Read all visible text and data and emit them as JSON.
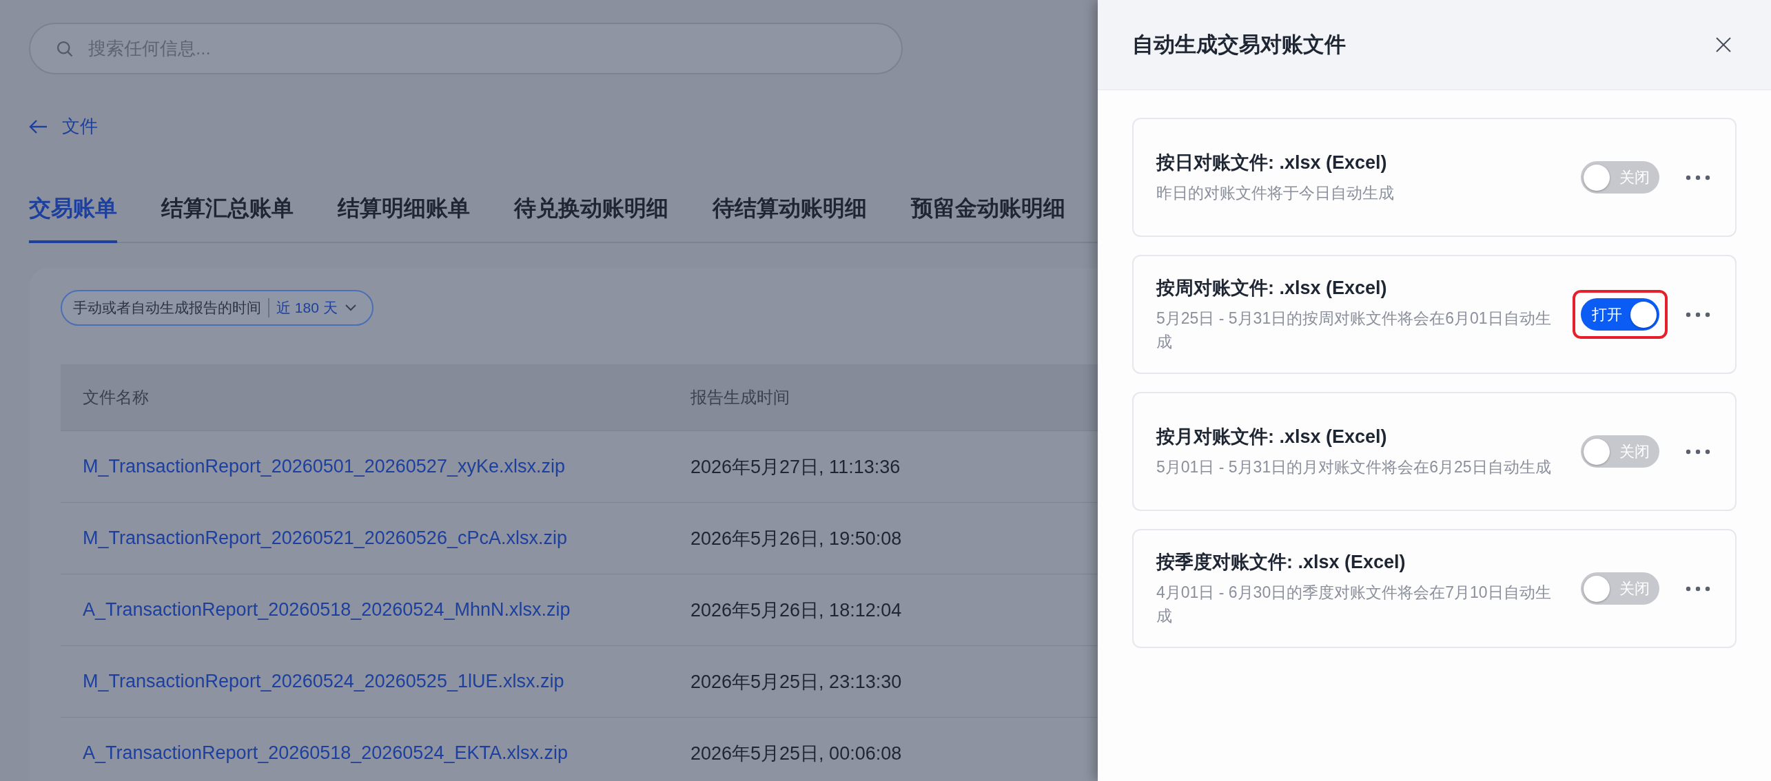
{
  "search": {
    "placeholder": "搜索任何信息..."
  },
  "back_link": {
    "label": "文件"
  },
  "tabs": [
    {
      "label": "交易账单",
      "selected": true
    },
    {
      "label": "结算汇总账单",
      "selected": false
    },
    {
      "label": "结算明细账单",
      "selected": false
    },
    {
      "label": "待兑换动账明细",
      "selected": false
    },
    {
      "label": "待结算动账明细",
      "selected": false
    },
    {
      "label": "预留金动账明细",
      "selected": false
    }
  ],
  "filter": {
    "label": "手动或者自动生成报告的时间",
    "value": "近 180 天"
  },
  "table": {
    "columns": [
      "文件名称",
      "报告生成时间"
    ],
    "rows": [
      {
        "file": "M_TransactionReport_20260501_20260527_xyKe.xlsx.zip",
        "time": "2026年5月27日, 11:13:36"
      },
      {
        "file": "M_TransactionReport_20260521_20260526_cPcA.xlsx.zip",
        "time": "2026年5月26日, 19:50:08"
      },
      {
        "file": "A_TransactionReport_20260518_20260524_MhnN.xlsx.zip",
        "time": "2026年5月26日, 18:12:04"
      },
      {
        "file": "M_TransactionReport_20260524_20260525_1lUE.xlsx.zip",
        "time": "2026年5月25日, 23:13:30"
      },
      {
        "file": "A_TransactionReport_20260518_20260524_EKTA.xlsx.zip",
        "time": "2026年5月25日, 00:06:08"
      }
    ]
  },
  "panel": {
    "title": "自动生成交易对账文件",
    "items": [
      {
        "title": "按日对账文件: .xlsx (Excel)",
        "description": "昨日的对账文件将于今日自动生成",
        "toggle_label": "关闭",
        "on": false,
        "highlighted": false
      },
      {
        "title": "按周对账文件: .xlsx (Excel)",
        "description": "5月25日 - 5月31日的按周对账文件将会在6月01日自动生成",
        "toggle_label": "打开",
        "on": true,
        "highlighted": true
      },
      {
        "title": "按月对账文件: .xlsx (Excel)",
        "description": "5月01日 - 5月31日的月对账文件将会在6月25日自动生成",
        "toggle_label": "关闭",
        "on": false,
        "highlighted": false
      },
      {
        "title": "按季度对账文件: .xlsx (Excel)",
        "description": "4月01日 - 6月30日的季度对账文件将会在7月10日自动生成",
        "toggle_label": "关闭",
        "on": false,
        "highlighted": false
      }
    ]
  }
}
